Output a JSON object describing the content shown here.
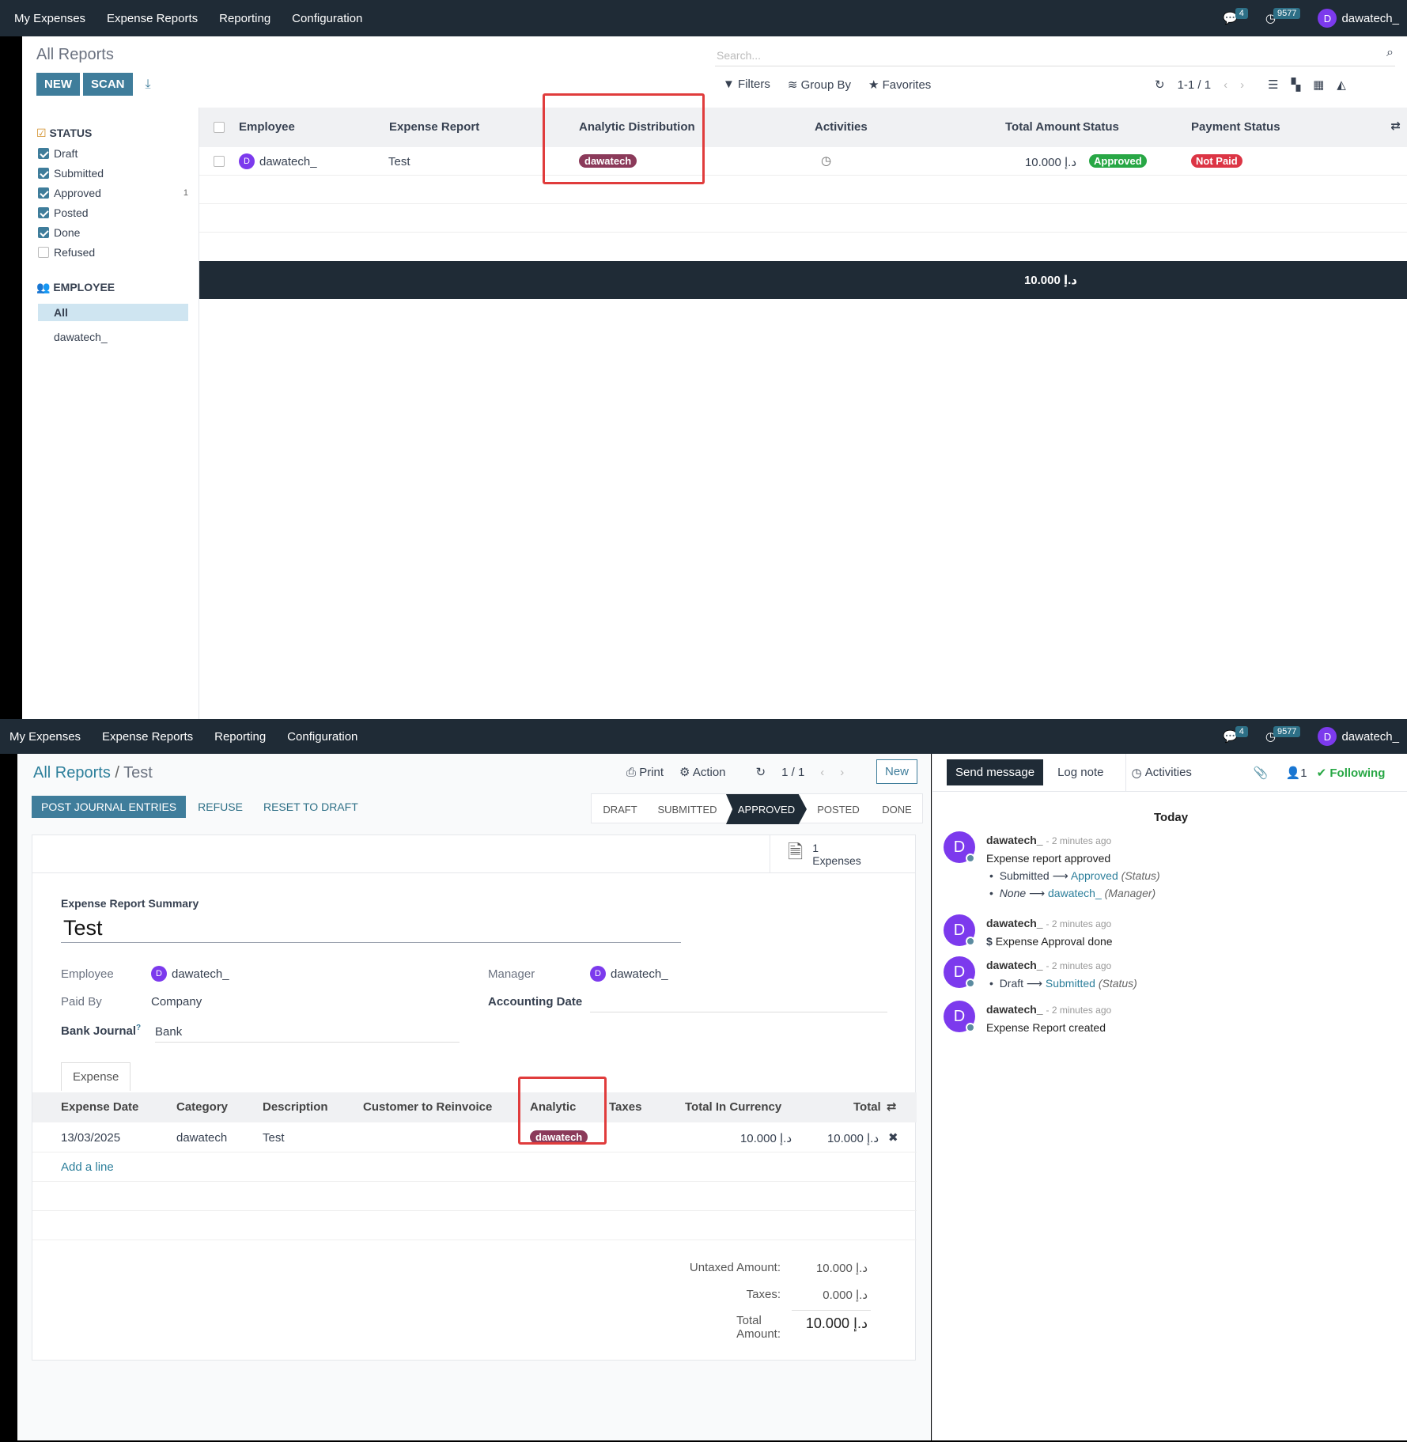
{
  "nav": {
    "items": [
      "My Expenses",
      "Expense Reports",
      "Reporting",
      "Configuration"
    ],
    "chat_count": "4",
    "activity_count": "9577",
    "user_initial": "D",
    "user": "dawatech_"
  },
  "list": {
    "title": "All Reports",
    "new_label": "NEW",
    "scan_label": "SCAN",
    "search_placeholder": "Search...",
    "filters": "Filters",
    "group_by": "Group By",
    "favorites": "Favorites",
    "pager": "1-1 / 1",
    "status_heading": "STATUS",
    "statuses": [
      {
        "label": "Draft",
        "checked": true,
        "count": ""
      },
      {
        "label": "Submitted",
        "checked": true,
        "count": ""
      },
      {
        "label": "Approved",
        "checked": true,
        "count": "1"
      },
      {
        "label": "Posted",
        "checked": true,
        "count": ""
      },
      {
        "label": "Done",
        "checked": true,
        "count": ""
      },
      {
        "label": "Refused",
        "checked": false,
        "count": ""
      }
    ],
    "employee_heading": "EMPLOYEE",
    "employee_all": "All",
    "employee_name": "dawatech_",
    "columns": [
      "Employee",
      "Expense Report",
      "Analytic Distribution",
      "Activities",
      "Total Amount",
      "Status",
      "Payment Status"
    ],
    "row": {
      "employee": "dawatech_",
      "report": "Test",
      "analytic": "dawatech",
      "total": "10.000 د.إ",
      "status": "Approved",
      "payment": "Not Paid"
    },
    "grand_total": "10.000 د.إ"
  },
  "form": {
    "breadcrumb_root": "All Reports",
    "breadcrumb_current": "Test",
    "print": "Print",
    "action": "Action",
    "pager": "1 / 1",
    "new_label": "New",
    "buttons": {
      "post": "POST JOURNAL ENTRIES",
      "refuse": "REFUSE",
      "reset": "RESET TO DRAFT"
    },
    "stages": [
      "DRAFT",
      "SUBMITTED",
      "APPROVED",
      "POSTED",
      "DONE"
    ],
    "active_stage": "APPROVED",
    "smart_count": "1",
    "smart_label": "Expenses",
    "summary_label": "Expense Report Summary",
    "summary_value": "Test",
    "employee_label": "Employee",
    "employee_value": "dawatech_",
    "manager_label": "Manager",
    "manager_value": "dawatech_",
    "paid_by_label": "Paid By",
    "paid_by_value": "Company",
    "accounting_date_label": "Accounting Date",
    "bank_journal_label": "Bank Journal",
    "bank_journal_help": "?",
    "bank_journal_value": "Bank",
    "tab": "Expense",
    "columns": [
      "Expense Date",
      "Category",
      "Description",
      "Customer to Reinvoice",
      "Analytic",
      "Taxes",
      "Total In Currency",
      "Total"
    ],
    "line": {
      "date": "13/03/2025",
      "category": "dawatech",
      "description": "Test",
      "analytic": "dawatech",
      "total_currency": "10.000 د.إ",
      "total": "10.000 د.إ"
    },
    "add_line": "Add a line",
    "untaxed_label": "Untaxed Amount:",
    "untaxed_value": "10.000 د.إ",
    "taxes_label": "Taxes:",
    "taxes_value": "0.000 د.إ",
    "total_label": "Total Amount:",
    "total_value": "10.000 د.إ"
  },
  "chatter": {
    "send": "Send message",
    "log": "Log note",
    "activities": "Activities",
    "followers": "1",
    "following": "Following",
    "day": "Today",
    "messages": [
      {
        "author": "dawatech_",
        "time": "- 2 minutes ago",
        "body": "Expense report approved",
        "changes": [
          {
            "from": "Submitted",
            "to": "Approved",
            "field": "(Status)"
          },
          {
            "from": "None",
            "to": "dawatech_",
            "field": "(Manager)"
          }
        ]
      },
      {
        "author": "dawatech_",
        "time": "- 2 minutes ago",
        "body": "Expense Approval done"
      },
      {
        "author": "dawatech_",
        "time": "- 2 minutes ago",
        "changes": [
          {
            "from": "Draft",
            "to": "Submitted",
            "field": "(Status)"
          }
        ]
      },
      {
        "author": "dawatech_",
        "time": "- 2 minutes ago",
        "body": "Expense Report created"
      }
    ]
  }
}
